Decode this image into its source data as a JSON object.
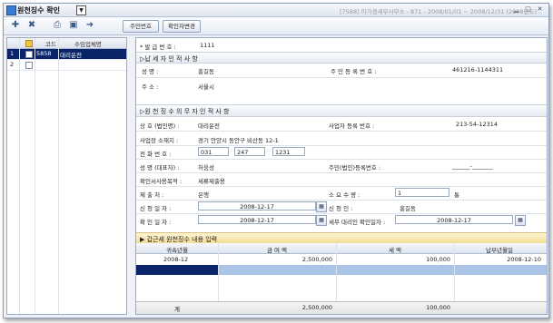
{
  "window": {
    "title": "원천징수 확인",
    "info": "[7588] 이가경세무사무소 - 871 - 2008/01/01 ~ 2008/12/31 (2008년도)",
    "controls": [
      "▁",
      "□",
      "✕"
    ]
  },
  "toolbar": {
    "icons": [
      "add-icon",
      "delete-icon",
      "print-icon",
      "save-icon",
      "exit-icon"
    ],
    "resident_btn": "주민번호",
    "confirmer_btn": "확인자변경"
  },
  "left_grid": {
    "headers": [
      "코드",
      "수임업체명"
    ],
    "rows": [
      {
        "no": "1",
        "code": "5858",
        "name": "대리운전"
      },
      {
        "no": "2",
        "code": "",
        "name": ""
      }
    ]
  },
  "form": {
    "issue_no_label": "* 발 급 번 호 :",
    "issue_no": "1111",
    "taxpayer_section": "▷납 세 자 인 적 사 항",
    "name_label": "성         명 :",
    "name": "홍길동",
    "rrn_label": "주 민   등 록 번 호 :",
    "rrn": "461216-1144311",
    "address_label": "주         소 :",
    "address": "서울시",
    "withholder_section": "▷원 천 징 수 의 무 자  인 적 사 항",
    "company_label": "상 호 (법인명) :",
    "company": "대리운전",
    "bizno_label": "사업자 등록 번호 :",
    "bizno": "213-54-12314",
    "bizaddr_label": "사업장 소재지 :",
    "bizaddr": "경기 안양시 동안구 비산동 12-1",
    "phone_label": "전   화   번   호 :",
    "phone1": "031",
    "phone2": "247",
    "phone3": "1231",
    "rep_label": "성 명 (대표자) :",
    "rep": "허웅성",
    "corp_rrn_label": "주민(법인)등록번호 :",
    "corp_rrn": "______-_______",
    "purpose_label": "확인서사용목적 :",
    "purpose": "세류제출용",
    "submit_label": "제       출       처 :",
    "submit": "은행",
    "qty_label": "소    요    수    량 :",
    "qty": "1",
    "qty_unit": "통",
    "req_date_label": "신   청   일   자 :",
    "req_date": "2008-12-17",
    "applicant_label": "신       청       인 :",
    "applicant": "홍길동",
    "confirm_date_label": "확   인   일   자 :",
    "confirm_date": "2008-12-17",
    "agent_date_label": "세무 대리인 확인일자 :",
    "agent_date": "2008-12-17",
    "income_section": "▶ 갑근세 원천징수 내용 입력",
    "table": {
      "headers": [
        "귀속년월",
        "금 여 액",
        "세       액",
        "납부년월일"
      ],
      "rows": [
        {
          "period": "2008-12",
          "pay": "2,500,000",
          "tax": "100,000",
          "date": "2008-12-10"
        }
      ],
      "total_label": "계",
      "total_pay": "2,500,000",
      "total_tax": "100,000"
    }
  }
}
